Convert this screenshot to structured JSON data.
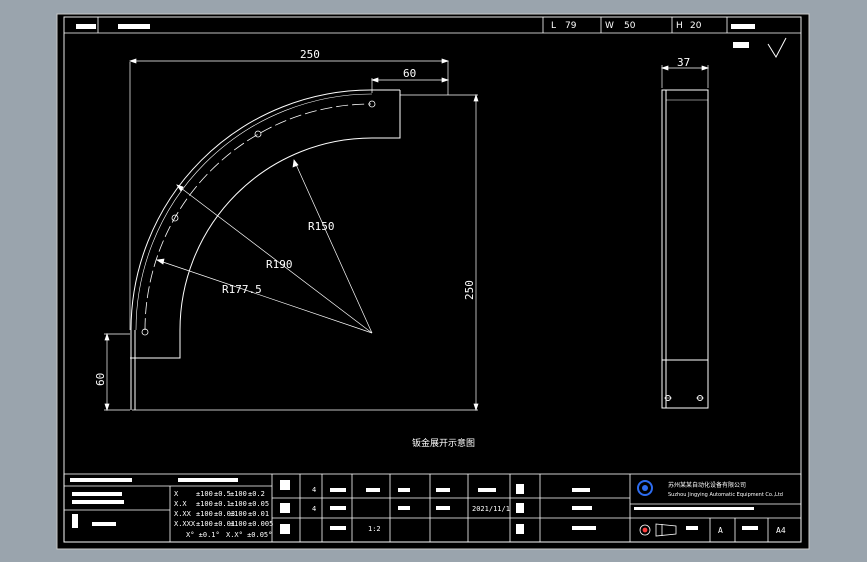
{
  "header": {
    "l_label": "L",
    "l_value": "79",
    "w_label": "W",
    "w_value": "50",
    "h_label": "H",
    "h_value": "20"
  },
  "drawing": {
    "dims": {
      "width_top": "250",
      "width_tab": "60",
      "height_right": "250",
      "height_left": "60",
      "side_width": "37",
      "r_inner": "R150",
      "r_outer": "R190",
      "r_mid": "R177.5"
    },
    "caption": "钣金展开示意图"
  },
  "title_block": {
    "tol_rows": [
      {
        "cls": "X",
        "a": "±100",
        "b": "±0.5",
        "c": "±100",
        "d": "±0.2"
      },
      {
        "cls": "X.X",
        "a": "±100",
        "b": "±0.1",
        "c": "±100",
        "d": "±0.05"
      },
      {
        "cls": "X.XX",
        "a": "±100",
        "b": "±0.03",
        "c": "±100",
        "d": "±0.01"
      },
      {
        "cls": "X.XXX",
        "a": "±100",
        "b": "±0.01",
        "c": "±100",
        "d": "±0.005"
      }
    ],
    "angle_tol_a": "X°  ±0.1°",
    "angle_tol_b": "X.X°  ±0.05°",
    "count_a": "4",
    "count_b": "4",
    "scale": "1:2",
    "date": "2021/11/1",
    "company_cn": "苏州某某自动化设备有限公司",
    "company_en": "Suzhou Jingying Automatic Equipment Co.,Ltd",
    "revision": "A",
    "paper": "A4"
  }
}
